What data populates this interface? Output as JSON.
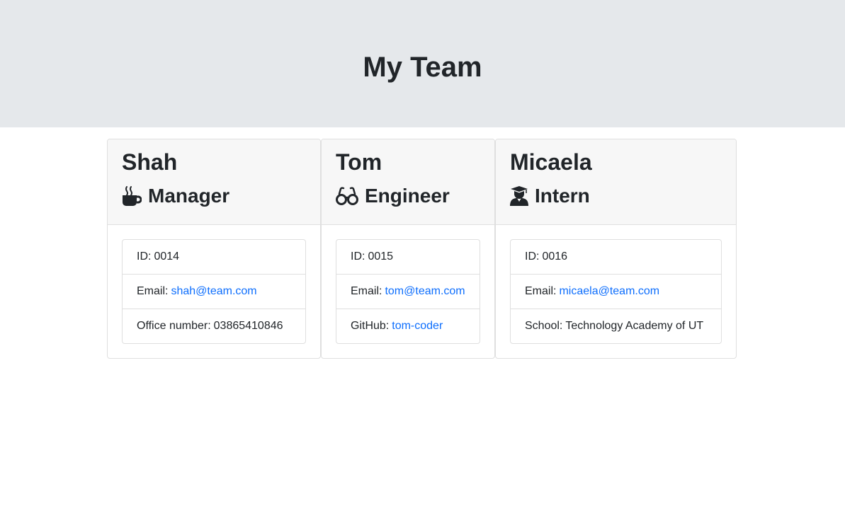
{
  "header": {
    "title": "My Team"
  },
  "team": [
    {
      "name": "Shah",
      "role": "Manager",
      "icon": "coffee-mug-icon",
      "id_label": "ID:",
      "id": "0014",
      "email_label": "Email:",
      "email": "shah@team.com",
      "extra_label": "Office number:",
      "extra_value": "03865410846"
    },
    {
      "name": "Tom",
      "role": "Engineer",
      "icon": "glasses-icon",
      "id_label": "ID:",
      "id": "0015",
      "email_label": "Email:",
      "email": "tom@team.com",
      "extra_label": "GitHub:",
      "extra_value": "tom-coder"
    },
    {
      "name": "Micaela",
      "role": "Intern",
      "icon": "graduate-icon",
      "id_label": "ID:",
      "id": "0016",
      "email_label": "Email:",
      "email": "micaela@team.com",
      "extra_label": "School:",
      "extra_value": "Technology Academy of UT"
    }
  ],
  "colors": {
    "header_bg": "#e5e8eb",
    "card_header_bg": "#f7f7f7",
    "link": "#0d6efd",
    "text": "#212529"
  }
}
